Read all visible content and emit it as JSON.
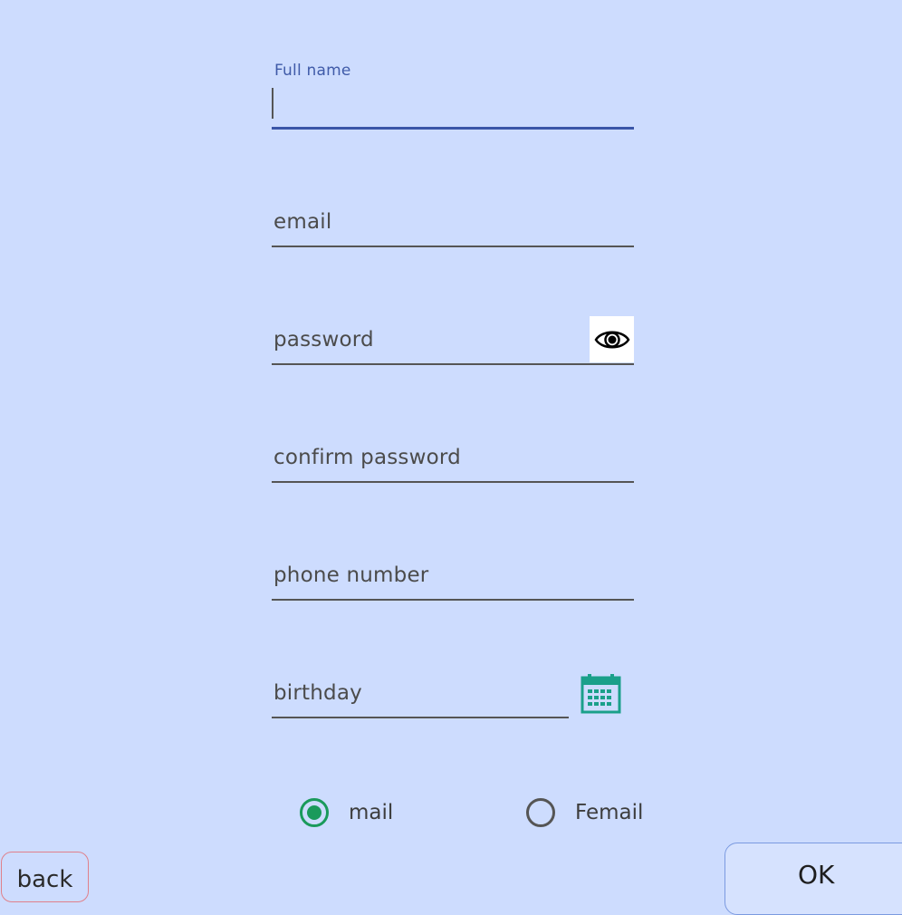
{
  "form": {
    "full_name": {
      "label": "Full name",
      "value": ""
    },
    "email": {
      "placeholder": "email"
    },
    "password": {
      "placeholder": "password"
    },
    "confirm_password": {
      "placeholder": "confirm password"
    },
    "phone": {
      "placeholder": "phone number"
    },
    "birthday": {
      "placeholder": "birthday"
    }
  },
  "gender": {
    "options": [
      {
        "label": "mail",
        "checked": true
      },
      {
        "label": "Femail",
        "checked": false
      }
    ]
  },
  "buttons": {
    "back_label": "back",
    "ok_label": "OK"
  },
  "icons": {
    "password_toggle": "eye-icon",
    "birthday_picker": "calendar-icon"
  },
  "colors": {
    "background": "#cddcfe",
    "focus_accent": "#3a56a8",
    "radio_accent": "#1a9a5b",
    "calendar_accent": "#1aa08a",
    "back_border": "#e0808a",
    "ok_border": "#7b9ae0"
  }
}
